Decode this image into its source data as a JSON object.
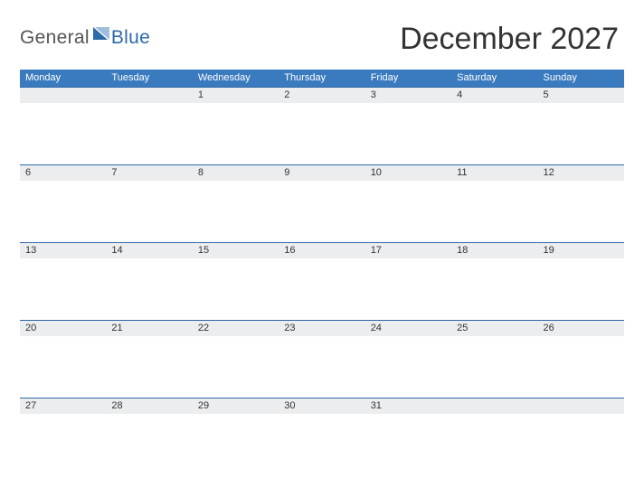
{
  "logo": {
    "part1": "General",
    "part2": "Blue"
  },
  "title": "December 2027",
  "days_of_week": [
    "Monday",
    "Tuesday",
    "Wednesday",
    "Thursday",
    "Friday",
    "Saturday",
    "Sunday"
  ],
  "weeks": [
    [
      "",
      "",
      "1",
      "2",
      "3",
      "4",
      "5"
    ],
    [
      "6",
      "7",
      "8",
      "9",
      "10",
      "11",
      "12"
    ],
    [
      "13",
      "14",
      "15",
      "16",
      "17",
      "18",
      "19"
    ],
    [
      "20",
      "21",
      "22",
      "23",
      "24",
      "25",
      "26"
    ],
    [
      "27",
      "28",
      "29",
      "30",
      "31",
      "",
      ""
    ]
  ]
}
